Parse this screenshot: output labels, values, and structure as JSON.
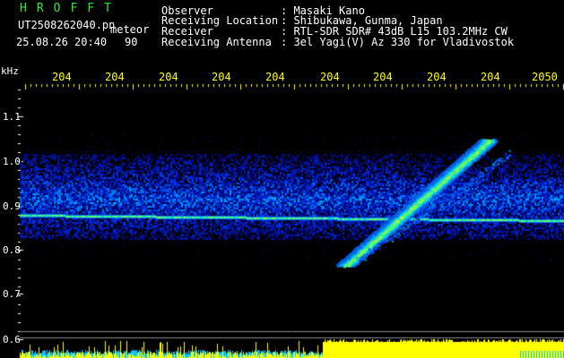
{
  "header": {
    "brand": "HROFFT",
    "filename": "UT2508262040.pn",
    "event_type": "meteor",
    "datetime": "25.08.26 20:40",
    "count": "90"
  },
  "station": {
    "observer_label": "Observer",
    "observer_value": ": Masaki Kano",
    "location_label": "Receiving Location",
    "location_value": ": Shibukawa, Gunma, Japan",
    "receiver_label": "Receiver",
    "receiver_value": ": RTL-SDR SDR# 43dB L15 103.2MHz CW",
    "antenna_label": "Receiving Antenna",
    "antenna_value": ": 3el Yagi(V) Az 330 for Vladivostok"
  },
  "axes": {
    "freq_unit": "kHz",
    "freq_ticks": [
      "1.1",
      "1.0",
      "0.9",
      "0.8",
      "0.7",
      "0.6"
    ],
    "time_ticks": [
      "204",
      "204",
      "204",
      "204",
      "204",
      "204",
      "204",
      "204",
      "204",
      "2050"
    ]
  },
  "colors": {
    "background": "#000000",
    "brand": "#33e633",
    "ticks": "#ffff00",
    "text": "#ffffff",
    "bottom_signal": "#ffff00",
    "bottom_noise": "#00c8ff"
  }
}
